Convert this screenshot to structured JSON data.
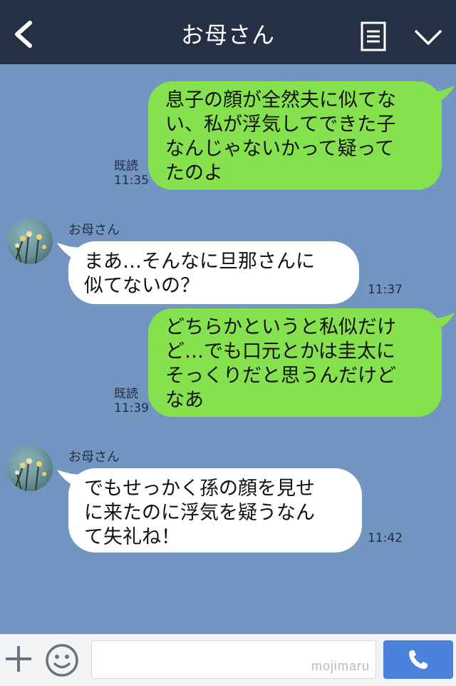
{
  "header": {
    "title": "お母さん"
  },
  "messages": [
    {
      "from": "me",
      "text": "息子の顔が全然夫に似てな\nい、私が浮気してできた子\nなんじゃないかって疑って\nたのよ",
      "read": "既読",
      "time": "11:35"
    },
    {
      "from": "them",
      "sender": "お母さん",
      "text": "まあ…そんなに旦那さんに\n似てないの？",
      "time": "11:37"
    },
    {
      "from": "me",
      "text": "どちらかというと私似だけ\nど…でも口元とかは圭太に\nそっくりだと思うんだけど\nなあ",
      "read": "既読",
      "time": "11:39"
    },
    {
      "from": "them",
      "sender": "お母さん",
      "text": "でもせっかく孫の顔を見せ\nに来たのに浮気を疑うなん\nて失礼ね！",
      "time": "11:42"
    }
  ],
  "inputbar": {
    "watermark": "mojimaru",
    "placeholder": ""
  },
  "colors": {
    "background": "#7395c2",
    "header": "#253044",
    "my_bubble": "#85e14d",
    "their_bubble": "#ffffff",
    "call_button": "#4a82dc"
  },
  "icons": {
    "back": "chevron-left-icon",
    "menu": "menu-icon",
    "collapse": "chevron-down-icon",
    "plus": "plus-icon",
    "emoji": "smile-icon",
    "call": "phone-icon"
  }
}
